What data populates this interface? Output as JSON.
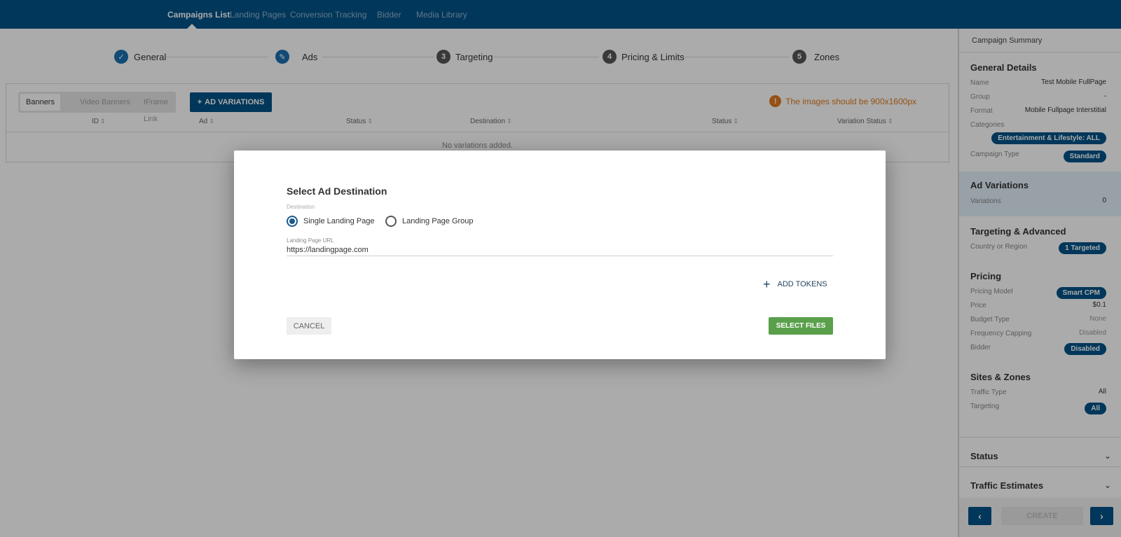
{
  "nav": {
    "items": [
      "Campaigns List",
      "Landing Pages",
      "Conversion Tracking",
      "Bidder",
      "Media Library"
    ],
    "active": "Campaigns List"
  },
  "stepper": {
    "steps": [
      {
        "label": "General",
        "marker": "✓",
        "state": "done"
      },
      {
        "label": "Ads",
        "marker": "✎",
        "state": "current"
      },
      {
        "label": "Targeting",
        "marker": "3",
        "state": "pending"
      },
      {
        "label": "Pricing & Limits",
        "marker": "4",
        "state": "pending"
      },
      {
        "label": "Zones",
        "marker": "5",
        "state": "pending"
      }
    ]
  },
  "ads": {
    "tabs": [
      "Banners",
      "Video Banners",
      "IFrame Link"
    ],
    "active_tab": "Banners",
    "add_variations_label": "AD VARIATIONS",
    "warning": "The images should be 900x1600px",
    "columns": [
      "ID",
      "Ad",
      "Status",
      "Destination",
      "Status",
      "Variation Status"
    ],
    "empty_text": "No variations added."
  },
  "sidebar": {
    "header": "Campaign Summary",
    "general": {
      "title": "General Details",
      "name_label": "Name",
      "name_value": "Test Mobile FullPage",
      "group_label": "Group",
      "group_value": "-",
      "format_label": "Format",
      "format_value": "Mobile Fullpage Interstitial",
      "categories_label": "Categories",
      "categories_value": "Entertainment & Lifestyle: ALL",
      "campaign_type_label": "Campaign Type",
      "campaign_type_value": "Standard"
    },
    "ad_variations": {
      "title": "Ad Variations",
      "variations_label": "Variations",
      "variations_value": "0"
    },
    "targeting": {
      "title": "Targeting & Advanced",
      "country_label": "Country or Region",
      "country_value": "1 Targeted"
    },
    "pricing": {
      "title": "Pricing",
      "model_label": "Pricing Model",
      "model_value": "Smart CPM",
      "price_label": "Price",
      "price_value": "$0.1",
      "budget_label": "Budget Type",
      "budget_value": "None",
      "freq_label": "Frequency Capping",
      "freq_value": "Disabled",
      "bidder_label": "Bidder",
      "bidder_value": "Disabled"
    },
    "sites": {
      "title": "Sites & Zones",
      "traffic_label": "Traffic Type",
      "traffic_value": "All",
      "targeting_label": "Targeting",
      "targeting_value": "All"
    },
    "status_title": "Status",
    "traffic_estimates_title": "Traffic Estimates",
    "create_label": "CREATE"
  },
  "modal": {
    "title": "Select Ad Destination",
    "destination_label": "Destination",
    "options": [
      "Single Landing Page",
      "Landing Page Group"
    ],
    "selected_option": "Single Landing Page",
    "url_label": "Landing Page URL",
    "url_value": "https://landingpage.com",
    "add_tokens_label": "ADD TOKENS",
    "cancel_label": "CANCEL",
    "select_files_label": "SELECT FILES"
  },
  "colors": {
    "brand": "#025287",
    "success": "#5aa04c",
    "warning": "#e07a1f"
  }
}
